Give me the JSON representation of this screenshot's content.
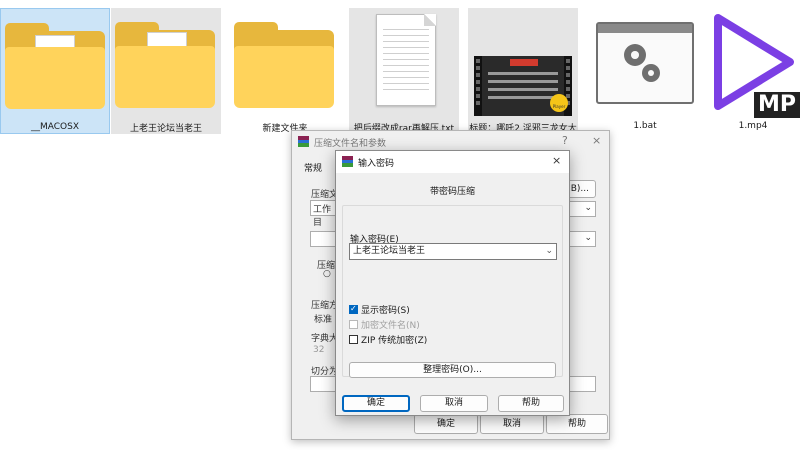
{
  "files": [
    {
      "name": "__MACOSX",
      "type": "folder"
    },
    {
      "name": "上老王论坛当老王",
      "type": "folder"
    },
    {
      "name": "新建文件夹",
      "type": "folder"
    },
    {
      "name": "把后缀改成rar再解压.txt",
      "type": "text"
    },
    {
      "name": "标题：哪吒2 淫邪三龙女大",
      "type": "video"
    },
    {
      "name": "1.bat",
      "type": "batch"
    },
    {
      "name": "1.mp4",
      "type": "video"
    }
  ],
  "video_thumb": {
    "badge": "Player"
  },
  "mp4_badge": "MP",
  "background_dialog": {
    "title": "压缩文件名和参数",
    "help_glyph": "?",
    "close_glyph": "×",
    "tab": "常规",
    "frag_archive": "压缩文",
    "frag_workdir": "工作目",
    "frag_browse": "浏(B)...",
    "frag_compress": "压缩",
    "frag_method": "压缩方",
    "frag_standard": "标准",
    "frag_dict": "字典大",
    "frag_dict_val": "32",
    "frag_split": "切分为",
    "ok": "确定",
    "cancel": "取消",
    "help": "帮助"
  },
  "password_dialog": {
    "title": "输入密码",
    "close_glyph": "×",
    "heading": "带密码压缩",
    "password_label": "输入密码(E)",
    "password_value": "上老王论坛当老王",
    "show_password": "显示密码(S)",
    "encrypt_filenames": "加密文件名(N)",
    "zip_legacy": "ZIP 传统加密(Z)",
    "organize": "整理密码(O)...",
    "ok": "确定",
    "cancel": "取消",
    "help": "帮助"
  },
  "colors": {
    "accent": "#0067c0",
    "folder": "#ffd35b",
    "mp4_purple": "#7b3fe4"
  }
}
